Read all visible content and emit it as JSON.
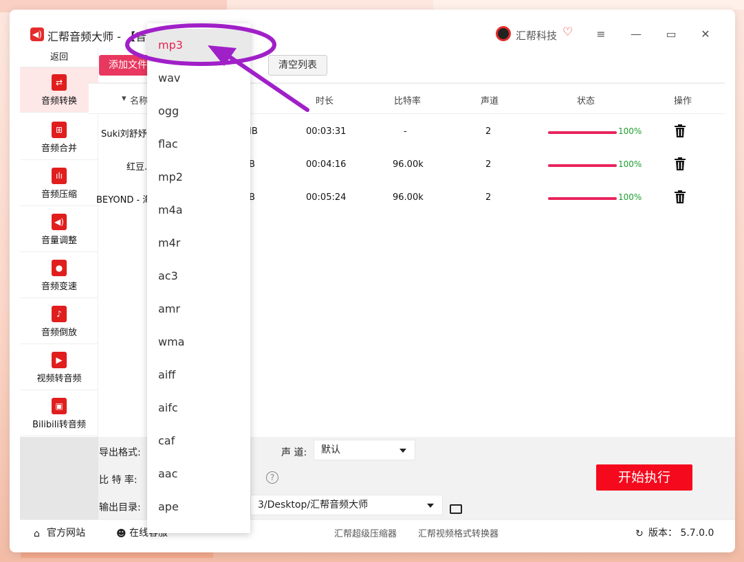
{
  "window": {
    "app_title": "汇帮音频大师  -  【音",
    "brand": "汇帮科技"
  },
  "sidebar": {
    "back": "返回",
    "items": [
      {
        "label": "音频转换",
        "icon": "audio-convert-icon"
      },
      {
        "label": "音频合并",
        "icon": "audio-merge-icon"
      },
      {
        "label": "音频压缩",
        "icon": "audio-compress-icon"
      },
      {
        "label": "音量调整",
        "icon": "volume-adjust-icon"
      },
      {
        "label": "音频变速",
        "icon": "audio-speed-icon"
      },
      {
        "label": "音频倒放",
        "icon": "audio-reverse-icon"
      },
      {
        "label": "视频转音频",
        "icon": "video-to-audio-icon"
      },
      {
        "label": "Bilibili转音频",
        "icon": "bilibili-icon"
      }
    ]
  },
  "toolbar": {
    "add_files": "添加文件",
    "clear_list": "清空列表"
  },
  "table": {
    "headers": {
      "name": "名称",
      "duration": "时长",
      "bitrate": "比特率",
      "channels": "声道",
      "status": "状态",
      "action": "操作"
    },
    "rows": [
      {
        "name": "Suki刘舒妤 -",
        "size": "IB",
        "duration": "00:03:31",
        "bitrate": "-",
        "channels": "2",
        "progress_pct": 100,
        "progress_text": "100%"
      },
      {
        "name": "红豆.l",
        "size": "B",
        "duration": "00:04:16",
        "bitrate": "96.00k",
        "channels": "2",
        "progress_pct": 100,
        "progress_text": "100%"
      },
      {
        "name": "BEYOND - 海",
        "size": "B",
        "duration": "00:05:24",
        "bitrate": "96.00k",
        "channels": "2",
        "progress_pct": 100,
        "progress_text": "100%"
      }
    ]
  },
  "settings": {
    "format_label": "导出格式:",
    "channel_label": "声  道:",
    "channel_value": "默认",
    "bitrate_label": "比 特 率:",
    "output_label": "输出目录:",
    "output_value": "3/Desktop/汇帮音频大师",
    "start": "开始执行"
  },
  "footer": {
    "website": "官方网站",
    "support": "在线客服",
    "link1": "汇帮超级压缩器",
    "link2": "汇帮视频格式转换器",
    "version": "版本：  5.7.0.0"
  },
  "dropdown": {
    "selected": "mp3",
    "options": [
      "mp3",
      "wav",
      "ogg",
      "flac",
      "mp2",
      "m4a",
      "m4r",
      "ac3",
      "amr",
      "wma",
      "aiff",
      "aifc",
      "caf",
      "aac",
      "ape"
    ]
  },
  "colors": {
    "accent": "#e6234f",
    "start_button": "#f5091c",
    "progress": "#e8245c",
    "annotation": "#a020c8"
  }
}
